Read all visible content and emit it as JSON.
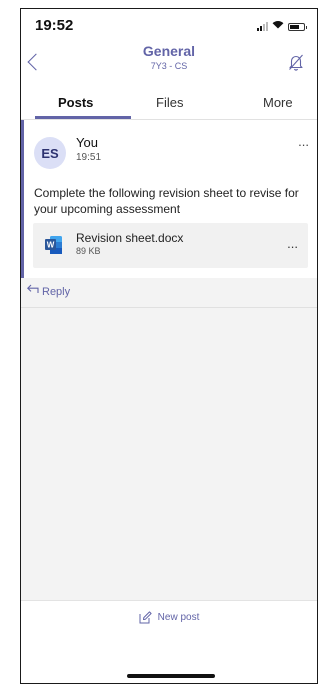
{
  "status_bar": {
    "time": "19:52"
  },
  "header": {
    "back_icon": "chevron-left-icon",
    "channel_title": "General",
    "team_subtitle": "7Y3 - CS",
    "notification_icon": "bell-off-icon"
  },
  "tabs": [
    {
      "label": "Posts",
      "active": true
    },
    {
      "label": "Files",
      "active": false
    },
    {
      "label": "More",
      "active": false
    }
  ],
  "post": {
    "avatar_initials": "ES",
    "author": "You",
    "time": "19:51",
    "more_label": "...",
    "message": "Complete the following revision sheet to revise for your upcoming assessment",
    "attachment": {
      "icon": "word-doc-icon",
      "file_name": "Revision sheet.docx",
      "file_size": "89 KB",
      "more_label": "..."
    },
    "reply_label": "Reply"
  },
  "footer": {
    "new_post_label": "New post",
    "compose_icon": "compose-icon"
  },
  "colors": {
    "accent": "#6264a7",
    "avatar_bg": "#dbdff6",
    "word_blue": "#2b579a"
  }
}
